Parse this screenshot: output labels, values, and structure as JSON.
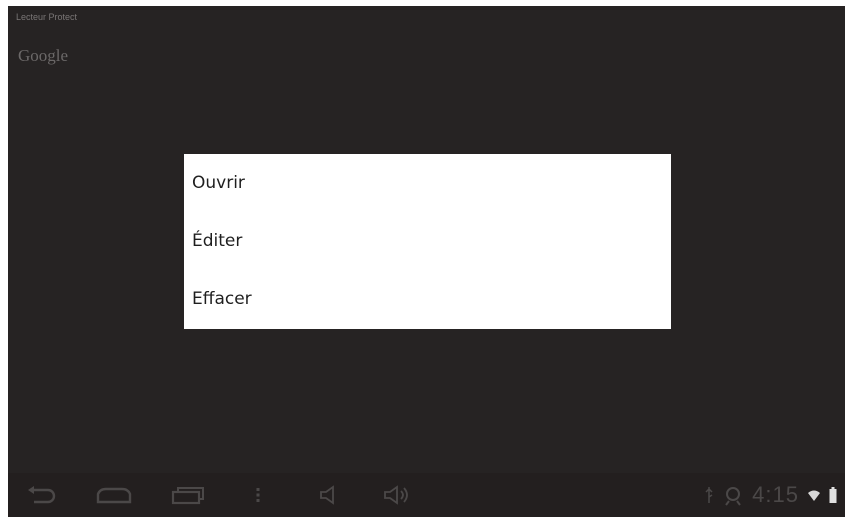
{
  "screen": {
    "top_label": "Lecteur Protect",
    "widget_title": "Google"
  },
  "menu": {
    "items": [
      {
        "label": "Ouvrir"
      },
      {
        "label": "Éditer"
      },
      {
        "label": "Effacer"
      }
    ]
  },
  "navbar": {
    "buttons": [
      "back-icon",
      "home-icon",
      "recent-apps-icon",
      "menu-dots-icon",
      "volume-down-icon",
      "volume-up-icon"
    ],
    "status": {
      "time": "4:15",
      "icons": [
        "usb-icon",
        "android-debug-icon",
        "wifi-icon",
        "battery-icon"
      ]
    }
  },
  "colors": {
    "screen_bg": "#262323",
    "menu_bg": "#ffffff",
    "nav_icon": "#4b4848"
  }
}
